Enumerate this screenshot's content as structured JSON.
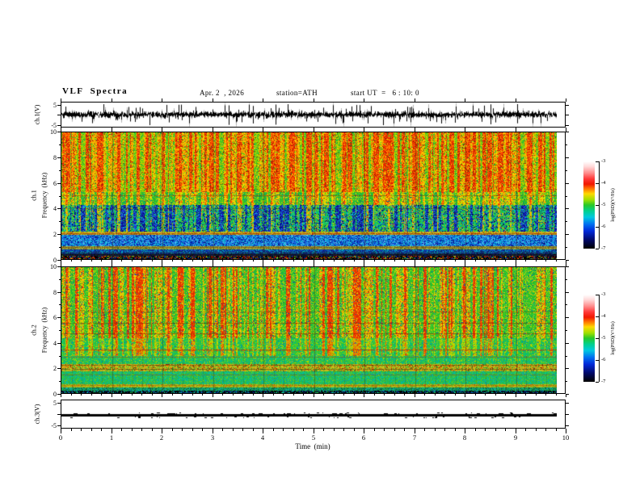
{
  "header": {
    "title": "VLF  Spectra",
    "date": "Apr. 2  , 2026",
    "station": "station=ATH",
    "start_ut": "start UT  =   6 : 10: 0"
  },
  "x_axis": {
    "label": "Time  (min)",
    "min": 0,
    "max": 10,
    "major_ticks": [
      0,
      1,
      2,
      3,
      4,
      5,
      6,
      7,
      8,
      9,
      10
    ],
    "minor_per_major": 5,
    "data_end_min": 9.8
  },
  "panels": {
    "wave1": {
      "ylabel": "ch.1(V)",
      "ytick_labels": [
        5,
        -5
      ],
      "yticks": [
        5,
        0,
        -5
      ],
      "ymin": -6.4,
      "ymax": 6.4
    },
    "spec1": {
      "ylabel_channel": "ch.1",
      "ylabel_axis": "Frequency  (kHz)",
      "yticks_major": [
        0,
        2,
        4,
        6,
        8,
        10
      ],
      "yticks_minor": [
        1,
        3,
        5,
        7,
        9
      ],
      "fmax": 10
    },
    "spec2": {
      "ylabel_channel": "ch.2",
      "ylabel_axis": "Frequency  (kHz)",
      "yticks_major": [
        0,
        2,
        4,
        6,
        8,
        10
      ],
      "yticks_minor": [
        1,
        3,
        5,
        7,
        9
      ],
      "fmax": 10
    },
    "wave3": {
      "ylabel": "ch.3(V)",
      "ytick_labels": [
        5,
        -5
      ],
      "yticks": [
        5,
        0,
        -5
      ],
      "ymin": -6.4,
      "ymax": 6.4
    }
  },
  "colorbar": {
    "label": "log(PSD)(V²/Hz)",
    "ticks": [
      -3,
      -4,
      -5,
      -6,
      -7
    ],
    "stops": [
      {
        "pos": 0.0,
        "color": "#ffffff"
      },
      {
        "pos": 0.06,
        "color": "#ffd8d8"
      },
      {
        "pos": 0.13,
        "color": "#ff9090"
      },
      {
        "pos": 0.2,
        "color": "#ff3838"
      },
      {
        "pos": 0.26,
        "color": "#f01800"
      },
      {
        "pos": 0.31,
        "color": "#ff7000"
      },
      {
        "pos": 0.37,
        "color": "#ffd800"
      },
      {
        "pos": 0.44,
        "color": "#a0e000"
      },
      {
        "pos": 0.5,
        "color": "#28c828"
      },
      {
        "pos": 0.57,
        "color": "#00d090"
      },
      {
        "pos": 0.64,
        "color": "#00c8e0"
      },
      {
        "pos": 0.72,
        "color": "#0070f0"
      },
      {
        "pos": 0.8,
        "color": "#0028d8"
      },
      {
        "pos": 0.9,
        "color": "#000868"
      },
      {
        "pos": 1.0,
        "color": "#000000"
      }
    ]
  },
  "chart_data": [
    {
      "id": "ch1_waveform",
      "type": "line",
      "ylabel": "ch.1(V)",
      "xlim": [
        0,
        9.8
      ],
      "ylim": [
        -6.4,
        6.4
      ],
      "x_units": "min",
      "params": {
        "baseline": 0,
        "noise_sigma": 0.9,
        "spike_prob": 0.05,
        "big_spike_prob": 0.016,
        "max_abs": 6.0,
        "seed": 20260402
      }
    },
    {
      "id": "ch1_spectrogram",
      "type": "heatmap",
      "fmax": 10,
      "xlim": [
        0,
        9.8
      ],
      "seed": 424242,
      "bands": [
        {
          "f_lo": 5.3,
          "f_hi": 10,
          "type": "streaky",
          "strong": [
            "#e02800",
            "#ff4a00",
            "#cc1800",
            "#ff6a00"
          ],
          "mid": [
            "#ff9800",
            "#ffc800",
            "#f0dc00",
            "#e8b000"
          ],
          "weak": [
            "#a8d800",
            "#50c818",
            "#20b440",
            "#88d400"
          ],
          "t_strong": 0.6,
          "t_mid": 0.3,
          "speckle": [
            "#7a3000",
            "#208820"
          ],
          "speckle_p": 0.05,
          "jitter": 0.35
        },
        {
          "f_lo": 4.3,
          "f_hi": 5.3,
          "type": "streaky",
          "strong": [
            "#ff5a00",
            "#e83000",
            "#ffc000"
          ],
          "mid": [
            "#e8d800",
            "#a8d800",
            "#ffd000"
          ],
          "weak": [
            "#28bc28",
            "#10b05c",
            "#58cc10"
          ],
          "t_strong": 0.8,
          "t_mid": 0.42,
          "speckle": [
            "#009898",
            "#106060"
          ],
          "speckle_p": 0.05,
          "jitter": 0.32
        },
        {
          "f_lo": 2.2,
          "f_hi": 4.3,
          "type": "streaky",
          "strong": [
            "#c8d400",
            "#e8c000",
            "#f09000"
          ],
          "mid": [
            "#20c050",
            "#00c078",
            "#30cc30"
          ],
          "weak": [
            "#1830cc",
            "#0a18a0",
            "#2858e8",
            "#0b0f88"
          ],
          "t_strong": 0.86,
          "t_mid": 0.4,
          "speckle": [
            "#000e66",
            "#00c8c8"
          ],
          "speckle_p": 0.16,
          "jitter": 0.3
        },
        {
          "f_lo": 1.95,
          "f_hi": 2.2,
          "type": "speckle",
          "colors": [
            "#c8c030",
            "#d8b020",
            "#a8b400",
            "#887020",
            "#c04000"
          ],
          "weights": [
            0.3,
            0.25,
            0.2,
            0.15,
            0.1
          ]
        },
        {
          "f_lo": 1.05,
          "f_hi": 1.95,
          "type": "speckle",
          "colors": [
            "#28a0e0",
            "#1060e0",
            "#0828b0",
            "#00c0d0",
            "#081480",
            "#60b8f0"
          ],
          "weights": [
            0.25,
            0.22,
            0.18,
            0.15,
            0.1,
            0.1
          ]
        },
        {
          "f_lo": 0.82,
          "f_hi": 1.05,
          "type": "speckle",
          "colors": [
            "#98b040",
            "#b0a030",
            "#687020",
            "#8a6a28",
            "#506818"
          ],
          "weights": [
            0.3,
            0.25,
            0.2,
            0.15,
            0.1
          ]
        },
        {
          "f_lo": 0.5,
          "f_hi": 0.82,
          "type": "speckle",
          "colors": [
            "#1040b8",
            "#082488",
            "#0090c0",
            "#102860",
            "#00b8b0"
          ],
          "weights": [
            0.3,
            0.25,
            0.2,
            0.15,
            0.1
          ]
        },
        {
          "f_lo": 0.28,
          "f_hi": 0.5,
          "type": "speckle",
          "colors": [
            "#0a0a24",
            "#101838",
            "#081c54",
            "#1c2c10",
            "#282828"
          ],
          "weights": [
            0.3,
            0.25,
            0.2,
            0.15,
            0.1
          ]
        },
        {
          "f_lo": 0,
          "f_hi": 0.28,
          "type": "speckle",
          "colors": [
            "#000000",
            "#c82000",
            "#0828a0",
            "#18a038",
            "#141414",
            "#c8c800"
          ],
          "weights": [
            0.42,
            0.18,
            0.14,
            0.1,
            0.1,
            0.06
          ]
        }
      ],
      "hlines": [
        {
          "f": 5.05,
          "rgb": "150,30,0",
          "alpha": 0.5
        },
        {
          "f": 4.0,
          "rgb": "60,40,10",
          "alpha": 0.35
        },
        {
          "f": 2.07,
          "rgb": "160,20,0",
          "alpha": 0.6
        },
        {
          "f": 0.95,
          "rgb": "130,70,20",
          "alpha": 0.55
        },
        {
          "f": 0.6,
          "rgb": "40,40,10",
          "alpha": 0.45
        }
      ],
      "minute_gridlines": {
        "rgb": "60,40,15",
        "alpha": 0.4
      }
    },
    {
      "id": "ch2_spectrogram",
      "type": "heatmap",
      "fmax": 10,
      "xlim": [
        0,
        9.8
      ],
      "seed": 777001,
      "bands": [
        {
          "f_lo": 4.4,
          "f_hi": 10,
          "type": "streaky",
          "strong": [
            "#e02800",
            "#ff4a00",
            "#d83800"
          ],
          "mid": [
            "#e8d000",
            "#ffb400",
            "#c8d800"
          ],
          "weak": [
            "#28c028",
            "#3cc818",
            "#14b448",
            "#50d030"
          ],
          "t_strong": 0.74,
          "t_mid": 0.48,
          "speckle": [
            "#0858c8",
            "#084888"
          ],
          "speckle_p": 0.04,
          "jitter": 0.35
        },
        {
          "f_lo": 3.0,
          "f_hi": 4.4,
          "type": "streaky",
          "strong": [
            "#e84800",
            "#e0a000"
          ],
          "mid": [
            "#c8d400",
            "#a0d000"
          ],
          "weak": [
            "#28c438",
            "#1cbc58",
            "#48cc20",
            "#00c080"
          ],
          "t_strong": 0.84,
          "t_mid": 0.55,
          "speckle": [
            "#00b0a0",
            "#0868c0"
          ],
          "speckle_p": 0.06,
          "jitter": 0.3
        },
        {
          "f_lo": 2.35,
          "f_hi": 3.0,
          "type": "speckle",
          "colors": [
            "#28c444",
            "#18b860",
            "#00c494",
            "#4ccc28",
            "#b0d400",
            "#089ab0"
          ],
          "weights": [
            0.3,
            0.22,
            0.15,
            0.15,
            0.1,
            0.08
          ]
        },
        {
          "f_lo": 1.75,
          "f_hi": 2.35,
          "type": "speckle",
          "colors": [
            "#c4c41c",
            "#e0a410",
            "#a0bc20",
            "#30b430",
            "#883008",
            "#d86000"
          ],
          "weights": [
            0.28,
            0.2,
            0.18,
            0.16,
            0.1,
            0.08
          ]
        },
        {
          "f_lo": 0.75,
          "f_hi": 1.75,
          "type": "speckle",
          "colors": [
            "#28bc4c",
            "#18b464",
            "#00c49c",
            "#40c830",
            "#08a0b8",
            "#70cc20"
          ],
          "weights": [
            0.28,
            0.24,
            0.18,
            0.14,
            0.08,
            0.08
          ]
        },
        {
          "f_lo": 0.45,
          "f_hi": 0.75,
          "type": "speckle",
          "colors": [
            "#b0c41c",
            "#c8b414",
            "#84a414",
            "#d06008",
            "#40b028"
          ],
          "weights": [
            0.3,
            0.28,
            0.2,
            0.12,
            0.1
          ]
        },
        {
          "f_lo": 0.22,
          "f_hi": 0.45,
          "type": "speckle",
          "colors": [
            "#1cac5c",
            "#08a484",
            "#188430",
            "#0a5a40",
            "#00b8b0"
          ],
          "weights": [
            0.3,
            0.25,
            0.2,
            0.15,
            0.1
          ]
        },
        {
          "f_lo": 0,
          "f_hi": 0.22,
          "type": "speckle",
          "colors": [
            "#000000",
            "#082488",
            "#00a0b0",
            "#18a038",
            "#101010"
          ],
          "weights": [
            0.46,
            0.18,
            0.14,
            0.12,
            0.1
          ]
        }
      ],
      "hlines": [
        {
          "f": 6.5,
          "rgb": "140,40,0",
          "alpha": 0.35
        },
        {
          "f": 5.6,
          "rgb": "120,30,0",
          "alpha": 0.5
        },
        {
          "f": 4.72,
          "rgb": "150,30,0",
          "alpha": 0.55
        },
        {
          "f": 3.45,
          "rgb": "200,30,0",
          "alpha": 0.65
        },
        {
          "f": 2.9,
          "rgb": "180,40,0",
          "alpha": 0.45
        },
        {
          "f": 2.25,
          "rgb": "110,20,0",
          "alpha": 0.5
        },
        {
          "f": 1.95,
          "rgb": "70,35,10",
          "alpha": 0.5
        },
        {
          "f": 1.5,
          "rgb": "170,40,0",
          "alpha": 0.4
        },
        {
          "f": 0.65,
          "rgb": "160,60,0",
          "alpha": 0.4
        }
      ],
      "fine_vlines": {
        "spacing_min": 0.2,
        "f_top": 3.1,
        "f_bottom": 0.22,
        "rgb": "30,60,20",
        "alpha": 0.22
      },
      "minute_gridlines": {
        "rgb": "60,40,15",
        "alpha": 0.4
      }
    },
    {
      "id": "ch3_waveform",
      "type": "line",
      "ylabel": "ch.3(V)",
      "xlim": [
        0,
        9.8
      ],
      "ylim": [
        -6.4,
        6.4
      ],
      "x_units": "min",
      "params": {
        "baseline": -0.2,
        "flat": true,
        "thickness_px": 3,
        "seed": 5150
      }
    }
  ]
}
